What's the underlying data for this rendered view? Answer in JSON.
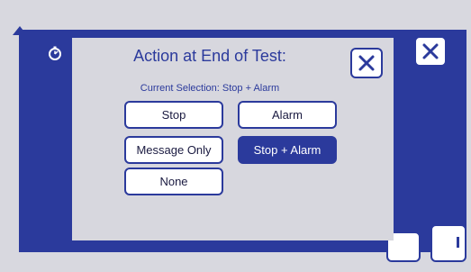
{
  "dialog": {
    "title": "Action at End of Test:",
    "current_selection": "Current Selection: Stop + Alarm",
    "options": [
      {
        "label": "Stop",
        "selected": false
      },
      {
        "label": "Alarm",
        "selected": false
      },
      {
        "label": "Message Only",
        "selected": false
      },
      {
        "label": "Stop + Alarm",
        "selected": true
      },
      {
        "label": "None",
        "selected": false
      }
    ]
  },
  "icons": {
    "timer": "stopwatch-icon",
    "close": "close-icon",
    "home": "home-icon"
  },
  "colors": {
    "accent": "#2b3a9c",
    "background": "#d8d8df",
    "button_bg": "#ffffff"
  }
}
